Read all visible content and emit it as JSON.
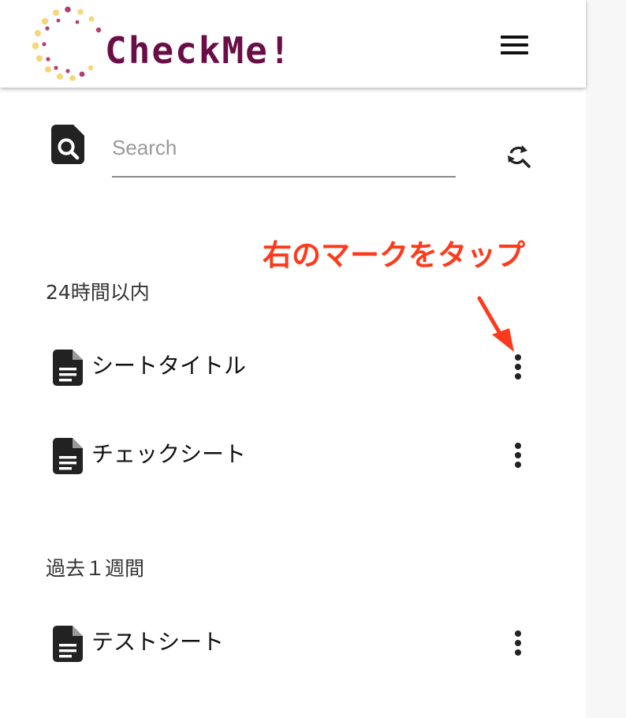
{
  "header": {
    "brand_name": "CheckMe!",
    "menu_icon": "hamburger-menu-icon",
    "colors": {
      "brand_text": "#6b0d46",
      "logo_yellow": "#f7d57a",
      "logo_magenta": "#b0406e"
    }
  },
  "search": {
    "placeholder": "Search",
    "value": "",
    "leading_icon": "search-document-icon",
    "action_icon": "refresh-search-icon"
  },
  "annotation": {
    "text": "右のマークをタップ",
    "color": "#fe3a1c",
    "points_to": "first-row-more-options-icon"
  },
  "sections": [
    {
      "title": "24時間以内",
      "items": [
        {
          "title": "シートタイトル",
          "icon": "document-icon",
          "action_icon": "more-vertical-icon"
        },
        {
          "title": "チェックシート",
          "icon": "document-icon",
          "action_icon": "more-vertical-icon"
        }
      ]
    },
    {
      "title": "過去１週間",
      "items": [
        {
          "title": "テストシート",
          "icon": "document-icon",
          "action_icon": "more-vertical-icon"
        }
      ]
    }
  ]
}
